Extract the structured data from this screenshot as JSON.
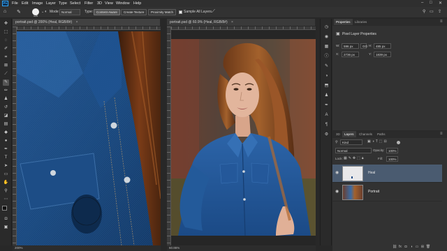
{
  "app": {
    "logo": "Ps"
  },
  "menu": [
    "File",
    "Edit",
    "Image",
    "Layer",
    "Type",
    "Select",
    "Filter",
    "3D",
    "View",
    "Window",
    "Help"
  ],
  "window_controls": [
    "–",
    "□",
    "✕"
  ],
  "options": {
    "brush_size": "125",
    "mode_label": "Mode:",
    "mode_value": "Normal",
    "type_label": "Type:",
    "type_buttons": [
      "Content-Aware",
      "Create Texture",
      "Proximity Match"
    ],
    "sample_all_layers": "Sample All Layers"
  },
  "documents": [
    {
      "tab": "portrait.psd @ 200% (Heal, RGB/8#)",
      "zoom": "200%"
    },
    {
      "tab": "portrait.psd @ 60.9% (Heal, RGB/8#)",
      "zoom": "60.86%"
    }
  ],
  "properties": {
    "tabs": [
      "Properties",
      "Libraries"
    ],
    "header": "Pixel Layer Properties",
    "w_label": "W:",
    "w_value": "596 px",
    "h_label": "H:",
    "h_value": "485 px",
    "link_label": "GO",
    "x_label": "X:",
    "x_value": "2736 px",
    "y_label": "Y:",
    "y_value": "1839 px"
  },
  "layers": {
    "tabs": [
      "3D",
      "Layers",
      "Channels",
      "Paths"
    ],
    "filter_kind": "Kind",
    "blend_mode": "Normal",
    "opacity_label": "Opacity:",
    "opacity_value": "100%",
    "lock_label": "Lock:",
    "fill_label": "Fill:",
    "fill_value": "100%",
    "items": [
      {
        "name": "Heal",
        "selected": true
      },
      {
        "name": "Portrait",
        "selected": false
      }
    ]
  },
  "colors": {
    "accent": "#31a8ff",
    "selected_layer": "#4a5b70",
    "app_bg": "#282828"
  }
}
